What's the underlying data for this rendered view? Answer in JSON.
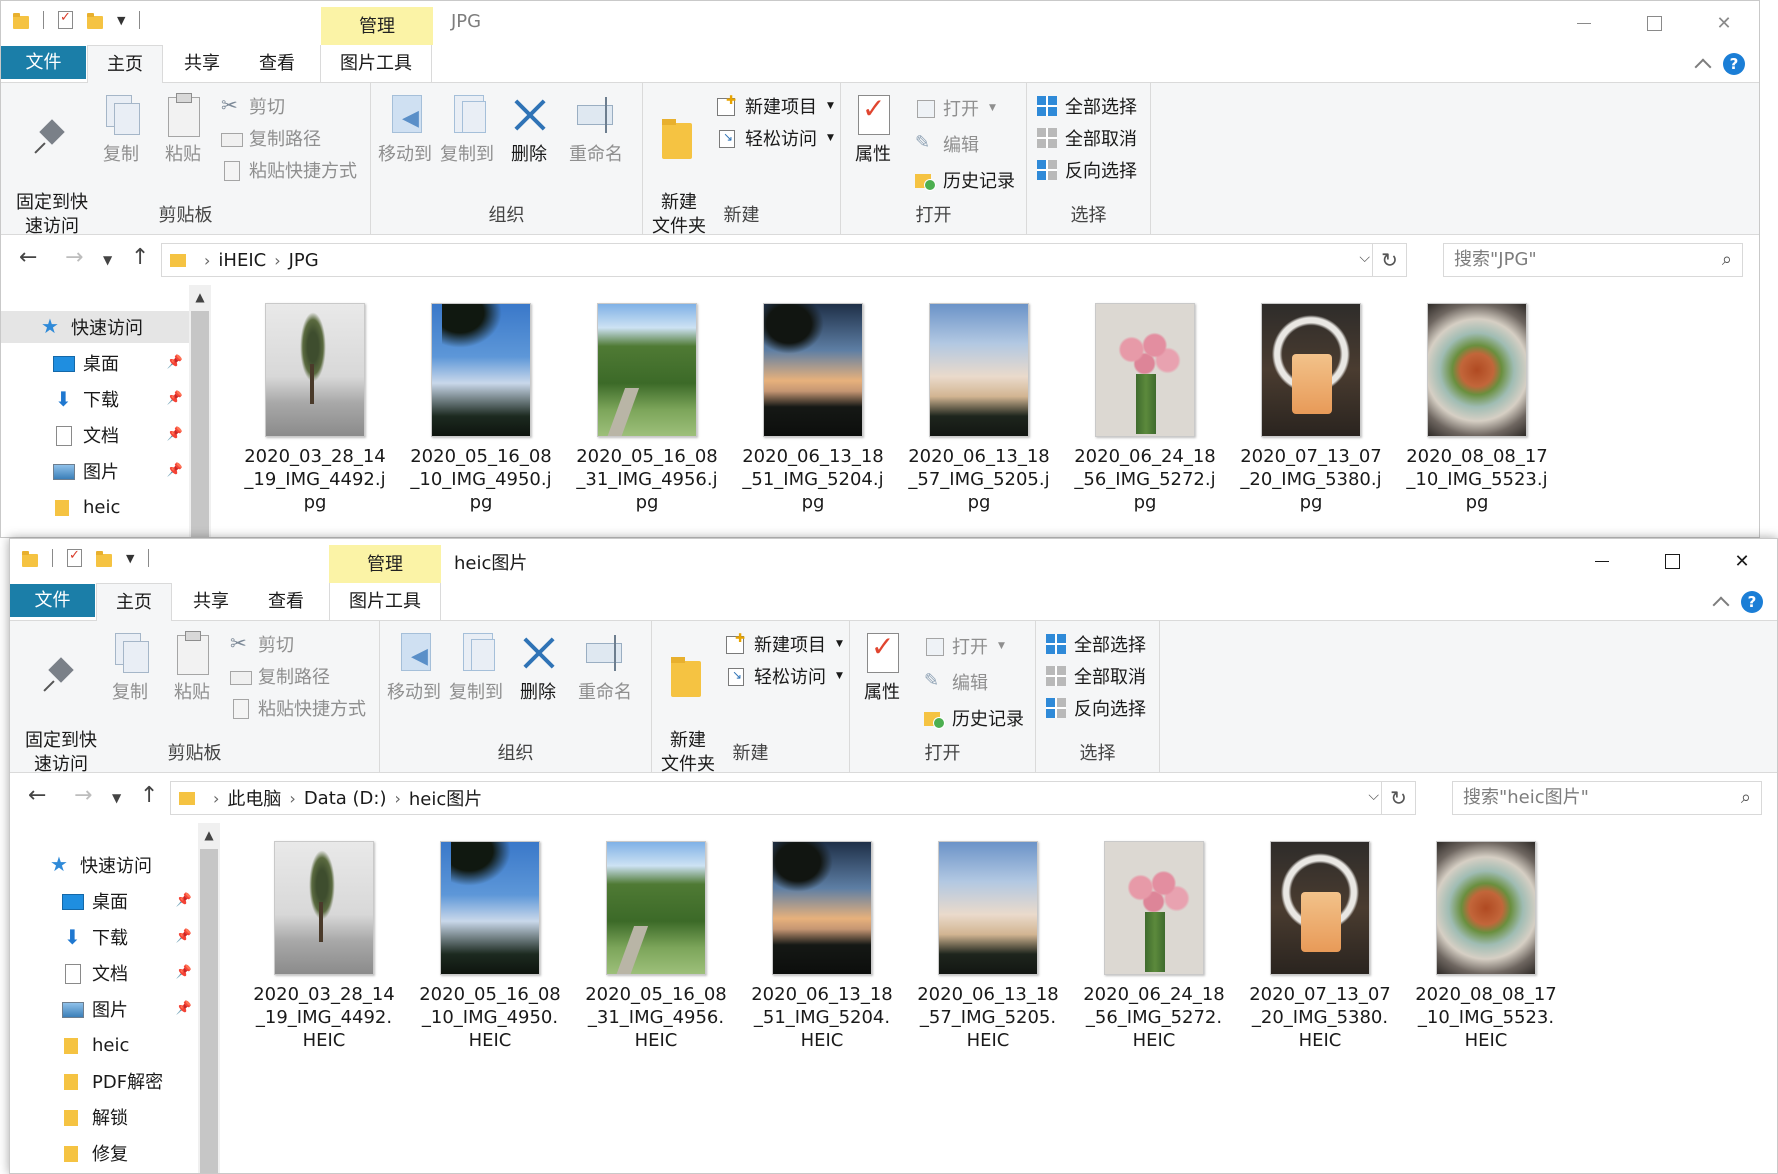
{
  "windows": [
    {
      "title": "JPG",
      "context_tab": "管理",
      "tabs": {
        "file": "文件",
        "home": "主页",
        "share": "共享",
        "view": "查看",
        "pictools": "图片工具"
      },
      "help": "?",
      "ribbon": {
        "clipboard": {
          "pin": "固定到快\n速访问",
          "copy": "复制",
          "paste": "粘贴",
          "cut": "剪切",
          "copy_path": "复制路径",
          "paste_shortcut": "粘贴快捷方式",
          "label": "剪贴板"
        },
        "organize": {
          "move_to": "移动到",
          "copy_to": "复制到",
          "delete": "删除",
          "rename": "重命名",
          "label": "组织"
        },
        "new": {
          "new_folder": "新建\n文件夹",
          "new_item": "新建项目",
          "easy_access": "轻松访问",
          "label": "新建"
        },
        "open": {
          "properties": "属性",
          "open": "打开",
          "edit": "编辑",
          "history": "历史记录",
          "label": "打开"
        },
        "select": {
          "select_all": "全部选择",
          "select_none": "全部取消",
          "invert": "反向选择",
          "label": "选择"
        }
      },
      "breadcrumb": [
        "iHEIC",
        "JPG"
      ],
      "search_placeholder": "搜索\"JPG\"",
      "nav": [
        {
          "label": "快速访问",
          "pinned": false
        },
        {
          "label": "桌面",
          "pinned": true
        },
        {
          "label": "下载",
          "pinned": true
        },
        {
          "label": "文档",
          "pinned": true
        },
        {
          "label": "图片",
          "pinned": true
        },
        {
          "label": "heic",
          "pinned": false
        }
      ],
      "files": [
        "2020_03_28_14_19_IMG_4492.jpg",
        "2020_05_16_08_10_IMG_4950.jpg",
        "2020_05_16_08_31_IMG_4956.jpg",
        "2020_06_13_18_51_IMG_5204.jpg",
        "2020_06_13_18_57_IMG_5205.jpg",
        "2020_06_24_18_56_IMG_5272.jpg",
        "2020_07_13_07_20_IMG_5380.jpg",
        "2020_08_08_17_10_IMG_5523.jpg"
      ]
    },
    {
      "title": "heic图片",
      "context_tab": "管理",
      "tabs": {
        "file": "文件",
        "home": "主页",
        "share": "共享",
        "view": "查看",
        "pictools": "图片工具"
      },
      "help": "?",
      "ribbon": {
        "clipboard": {
          "pin": "固定到快\n速访问",
          "copy": "复制",
          "paste": "粘贴",
          "cut": "剪切",
          "copy_path": "复制路径",
          "paste_shortcut": "粘贴快捷方式",
          "label": "剪贴板"
        },
        "organize": {
          "move_to": "移动到",
          "copy_to": "复制到",
          "delete": "删除",
          "rename": "重命名",
          "label": "组织"
        },
        "new": {
          "new_folder": "新建\n文件夹",
          "new_item": "新建项目",
          "easy_access": "轻松访问",
          "label": "新建"
        },
        "open": {
          "properties": "属性",
          "open": "打开",
          "edit": "编辑",
          "history": "历史记录",
          "label": "打开"
        },
        "select": {
          "select_all": "全部选择",
          "select_none": "全部取消",
          "invert": "反向选择",
          "label": "选择"
        }
      },
      "breadcrumb": [
        "此电脑",
        "Data (D:)",
        "heic图片"
      ],
      "search_placeholder": "搜索\"heic图片\"",
      "nav": [
        {
          "label": "快速访问",
          "pinned": false
        },
        {
          "label": "桌面",
          "pinned": true
        },
        {
          "label": "下载",
          "pinned": true
        },
        {
          "label": "文档",
          "pinned": true
        },
        {
          "label": "图片",
          "pinned": true
        },
        {
          "label": "heic",
          "pinned": false
        },
        {
          "label": "PDF解密",
          "pinned": false
        },
        {
          "label": "解锁",
          "pinned": false
        },
        {
          "label": "修复",
          "pinned": false
        }
      ],
      "files": [
        "2020_03_28_14_19_IMG_4492.HEIC",
        "2020_05_16_08_10_IMG_4950.HEIC",
        "2020_05_16_08_31_IMG_4956.HEIC",
        "2020_06_13_18_51_IMG_5204.HEIC",
        "2020_06_13_18_57_IMG_5205.HEIC",
        "2020_06_24_18_56_IMG_5272.HEIC",
        "2020_07_13_07_20_IMG_5380.HEIC",
        "2020_08_08_17_10_IMG_5523.HEIC"
      ]
    }
  ]
}
